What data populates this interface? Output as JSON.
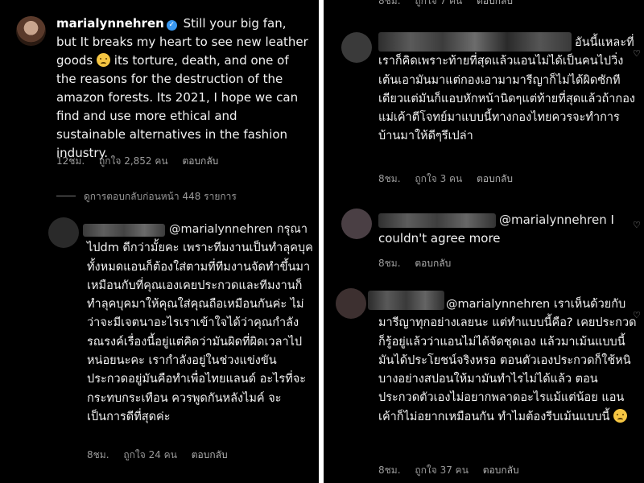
{
  "left_panel": {
    "main_comment": {
      "username": "marialynnehren",
      "text_a": "Still your big fan, but It breaks my heart to see new leather goods",
      "text_b": "its torture, death, and one of the reasons for the destruction of the amazon forests. Its 2021, I hope we can find and use more ethical and sustainable alternatives in the fashion industry.",
      "time": "12ชม.",
      "likes": "ถูกใจ 2,852 คน",
      "reply": "ตอบกลับ"
    },
    "view_replies": "ดูการตอบกลับก่อนหน้า 448 รายการ",
    "reply_1": {
      "mention": "@marialynnehren",
      "text": "กรุณาไปdm ดีกว่ามั้ยคะ เพราะทีมงานเป็นทำลุคบุค ทั้งหมดแอนก็ต้องใส่ตามที่ทีมงานจัดทำขึ้นมา เหมือนกับที่คุณเองเคยประกวดและทีมงานก็ทำลุคบุคมาให้คุณใส่คุณถือเหมือนกันค่ะ ไม่ว่าจะมีเจตนาอะไรเราเข้าใจได้ว่าคุณกำลังรณรงค์เรื่องนี้อยู่แต่คิดว่ามันผิดที่ผิดเวลาไปหน่อยนะคะ เรากำลังอยู่ในช่วงแข่งขันประกวดอยู่มันคือทำเพื่อไทยแลนด์ อะไรที่จะกระทบกระเทือน ควรพูดกันหลังไมค์ จะเป็นการดีที่สุดค่ะ",
      "time": "8ชม.",
      "likes": "ถูกใจ 24 คน",
      "reply": "ตอบกลับ"
    }
  },
  "right_panel": {
    "top_meta": {
      "time": "8ชม.",
      "likes": "ถูกใจ 7 คน",
      "reply": "ตอบกลับ"
    },
    "comment_1": {
      "text": "อันนี้แหละที่เราก็คิดเพราะท้ายที่สุดแล้วแอนไม่ได้เป็นคนไปวิ่งเต้นเอามันมาแต่กองเอามามารีญาก็ไม่ได้ผิดซักทีเดียวแต่มันก็แอบหักหน้านิดๆแต่ท้ายที่สุดแล้วถ้ากองแม่เค้าตีโจทย์มาแบบนี้ทางกองไทยควรจะทำการบ้านมาให้ดีๆรึเปล่า",
      "time": "8ชม.",
      "likes": "ถูกใจ 3 คน",
      "reply": "ตอบกลับ"
    },
    "comment_2": {
      "mention": "@marialynnehren",
      "text": "I couldn't agree more",
      "time": "8ชม.",
      "reply": "ตอบกลับ"
    },
    "comment_3": {
      "mention": "@marialynnehren",
      "text": "เราเห็นด้วยกับมารีญาทุกอย่างเลยนะ แต่ทำแบบนี้คือ? เคยประกวดก็รู้อยู่แล้วว่าแอนไม่ได้จัดชุดเอง แล้วมาเม้นแบบนี้มันได้ประโยชน์จริงหรอ ตอนตัวเองประกวดก็ใช้หนิ บางอย่างสปอนให้มามันทำไรไม่ได้แล้ว ตอนประกวดตัวเองไม่อยากพลาดอะไรแม้แต่น้อย แอนเค้าก็ไม่อยากเหมือนกัน ทำไมต้องรีบเม้นแบบนี้",
      "time": "8ชม.",
      "likes": "ถูกใจ 37 คน",
      "reply": "ตอบกลับ"
    }
  },
  "colors": {
    "background": "#000000",
    "text": "#f2f2f2",
    "meta": "#9a9a9a",
    "verified": "#3897f0",
    "divider": "#ffffff"
  },
  "icons": [
    "verified-badge-icon",
    "crying-face-emoji-icon",
    "heart-outline-icon"
  ]
}
